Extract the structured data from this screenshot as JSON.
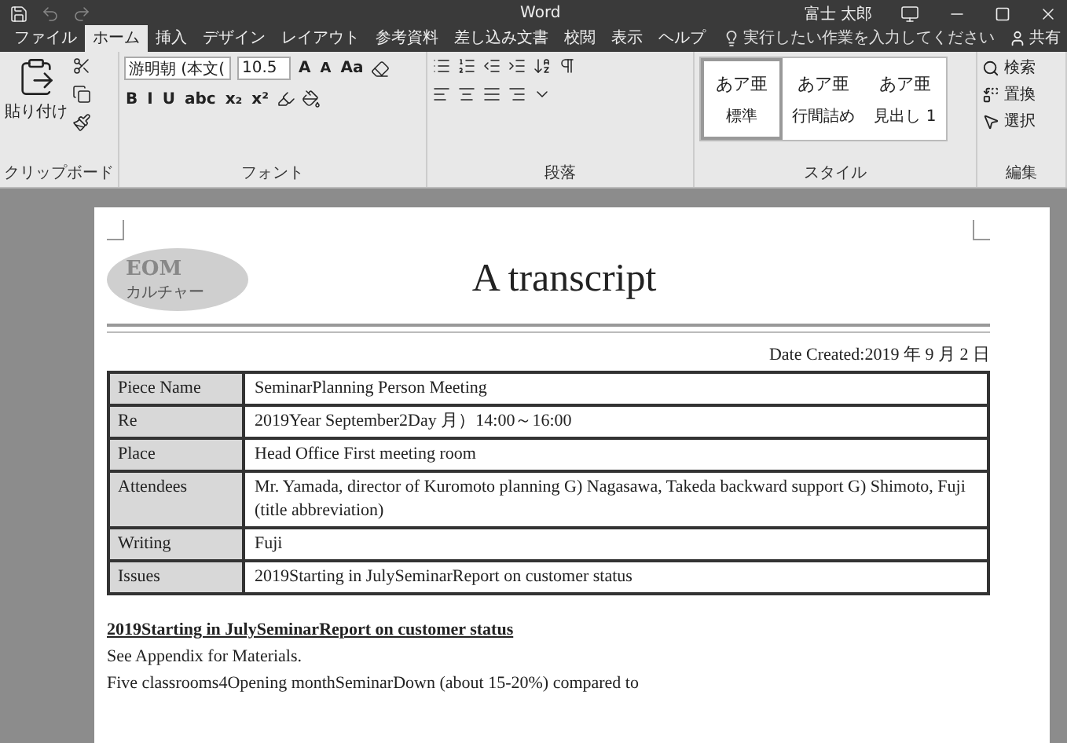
{
  "title_bar": {
    "app": "Word",
    "user": "富士 太郎"
  },
  "tabs": [
    {
      "label": "ファイル",
      "selected": false
    },
    {
      "label": "ホーム",
      "selected": true
    },
    {
      "label": "挿入",
      "selected": false
    },
    {
      "label": "デザイン",
      "selected": false
    },
    {
      "label": "レイアウト",
      "selected": false
    },
    {
      "label": "参考資料",
      "selected": false
    },
    {
      "label": "差し込み文書",
      "selected": false
    },
    {
      "label": "校閲",
      "selected": false
    },
    {
      "label": "表示",
      "selected": false
    },
    {
      "label": "ヘルプ",
      "selected": false
    }
  ],
  "tell_me": {
    "placeholder": "実行したい作業を入力してください"
  },
  "share": "共有",
  "ribbon": {
    "clipboard": {
      "paste": "貼り付け",
      "label": "クリップボード"
    },
    "font": {
      "name": "游明朝 (本文(",
      "size": "10.5",
      "grow": "A",
      "shrink": "A",
      "case": "Aa",
      "format": [
        "B",
        "I",
        "U",
        "abc",
        "x₂",
        "x²"
      ],
      "label": "フォント"
    },
    "paragraph": {
      "label": "段落"
    },
    "styles": {
      "items": [
        {
          "sample": "あア亜",
          "name": "標準",
          "selected": true
        },
        {
          "sample": "あア亜",
          "name": "行間詰め",
          "selected": false
        },
        {
          "sample": "あア亜",
          "name": "見出し 1",
          "selected": false
        }
      ],
      "label": "スタイル"
    },
    "editing": {
      "items": [
        "検索",
        "置換",
        "選択"
      ],
      "label": "編集"
    }
  },
  "document": {
    "logo": {
      "top": "EOM",
      "bottom": "カルチャー"
    },
    "title": "A transcript",
    "date": "Date Created:2019 年 9 月 2 日",
    "table": [
      {
        "label": "Piece Name",
        "value": "SeminarPlanning Person Meeting"
      },
      {
        "label": "Re",
        "value": "2019Year September2Day 月）14:00～16:00"
      },
      {
        "label": "Place",
        "value": "Head Office First meeting room"
      },
      {
        "label": "Attendees",
        "value": "Mr. Yamada, director of Kuromoto planning G) Nagasawa, Takeda backward support G) Shimoto, Fuji (title abbreviation)"
      },
      {
        "label": "Writing",
        "value": "Fuji"
      },
      {
        "label": "Issues",
        "value": "2019Starting in JulySeminarReport on customer status"
      }
    ],
    "heading": "2019Starting in JulySeminarReport on customer status",
    "paragraphs": [
      "See Appendix for Materials.",
      "Five classrooms4Opening monthSeminarDown (about 15-20%) compared to"
    ]
  }
}
